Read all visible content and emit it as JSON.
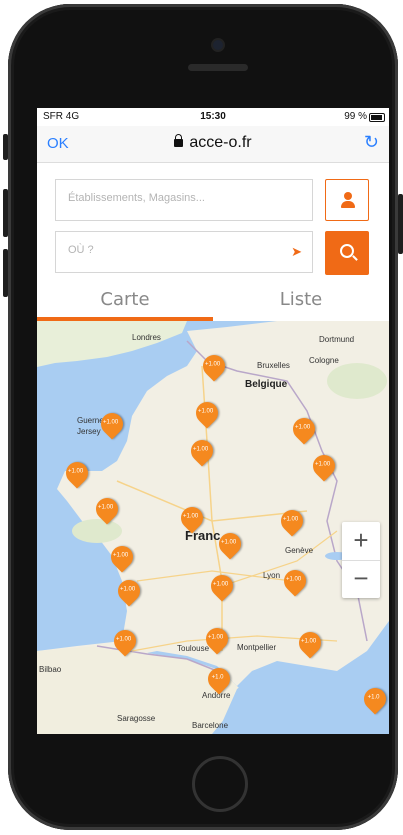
{
  "status_bar": {
    "carrier": "SFR  4G",
    "time": "15:30",
    "battery": "99 %"
  },
  "browser": {
    "back_label": "OK",
    "url": "acce-o.fr",
    "reload_icon": "reload-icon"
  },
  "search": {
    "establishment_placeholder": "Établissements, Magasins...",
    "location_placeholder": "OÙ ?",
    "user_icon": "user-icon",
    "search_icon": "search-icon",
    "location_icon": "location-arrow-icon"
  },
  "tabs": [
    {
      "label": "Carte",
      "active": true
    },
    {
      "label": "Liste",
      "active": false
    }
  ],
  "map": {
    "labels": {
      "london": "Londres",
      "brussels": "Bruxelles",
      "belgique": "Belgique",
      "cologne": "Cologne",
      "dortmund": "Dortmund",
      "france": "Franc",
      "toulouse": "Toulouse",
      "montpellier": "Montpellier",
      "bilbao": "Bilbao",
      "barcelona": "Barcelone",
      "zaragoza": "Saragosse",
      "andorra": "Andorre",
      "lyon": "Lyon",
      "geneve": "Genève",
      "jersey": "Jersey",
      "guernsey": "Guernesey"
    },
    "markers": [
      {
        "label": "+1.00"
      },
      {
        "label": "+1.00"
      },
      {
        "label": "+1.00"
      },
      {
        "label": "+1.00"
      },
      {
        "label": "+1.00"
      },
      {
        "label": "+1.00"
      },
      {
        "label": "+1.00"
      },
      {
        "label": "+1.00"
      },
      {
        "label": "+1.00"
      },
      {
        "label": "+1.00"
      },
      {
        "label": "+1.00"
      },
      {
        "label": "+1.00"
      },
      {
        "label": "+1.00"
      },
      {
        "label": "+1.00"
      },
      {
        "label": "+1.00"
      },
      {
        "label": "+1.00"
      },
      {
        "label": "+1.00"
      },
      {
        "label": "+1.00"
      },
      {
        "label": "+1.00"
      },
      {
        "label": "+1.00"
      },
      {
        "label": "+1.0"
      },
      {
        "label": "+1.0"
      }
    ],
    "zoom_in": "+",
    "zoom_out": "−"
  },
  "colors": {
    "accent": "#f06a16",
    "marker": "#f5891f",
    "link": "#2a7fff",
    "water": "#a9cdf2",
    "land": "#f2efe4"
  }
}
